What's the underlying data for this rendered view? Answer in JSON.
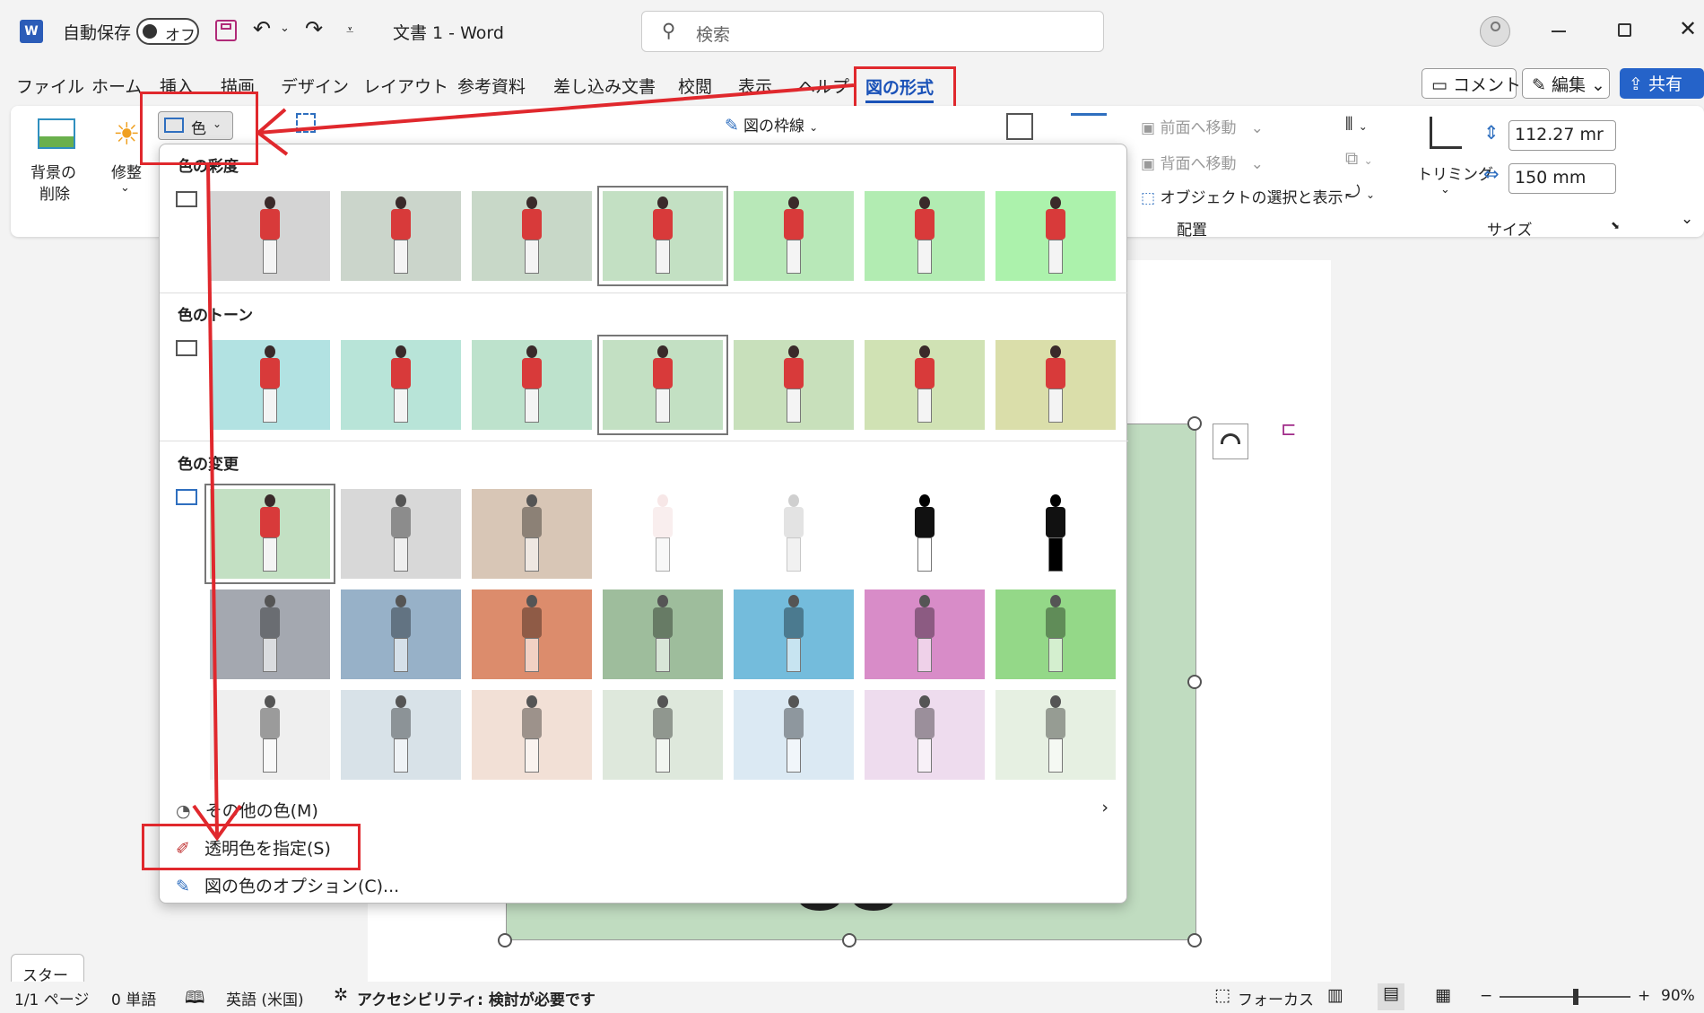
{
  "titlebar": {
    "app_icon": "word-icon",
    "autosave_label": "自動保存",
    "autosave_state": "オフ",
    "doc_title": "文書 1  -  Word",
    "search_placeholder": "検索"
  },
  "menu_tabs": [
    "ファイル",
    "ホーム",
    "挿入",
    "描画",
    "デザイン",
    "レイアウト",
    "参考資料",
    "差し込み文書",
    "校閲",
    "表示",
    "ヘルプ"
  ],
  "active_tab": "図の形式",
  "top_buttons": {
    "comment": "コメント",
    "edit": "編集",
    "share": "共有"
  },
  "ribbon": {
    "remove_bg": [
      "背景の",
      "削除"
    ],
    "corrections": "修整",
    "color_button": "色",
    "picture_border": "図の枠線",
    "bring_forward": "前面へ移動",
    "send_backward": "背面へ移動",
    "selection_pane": "オブジェクトの選択と表示",
    "arrange_group": "配置",
    "crop": "トリミング",
    "height_value": "112.27 mr",
    "width_value": "150 mm",
    "size_group": "サイズ"
  },
  "dropdown": {
    "saturation_title": "色の彩度",
    "tone_title": "色のトーン",
    "recolor_title": "色の変更",
    "more_colors": "その他の色(M)",
    "set_transparent": "透明色を指定(S)",
    "color_options": "図の色のオプション(C)...",
    "saturation_row": [
      "#d4d4d4",
      "#cbd5cb",
      "#c8d8c8",
      "#c3e0c3",
      "#b8e8b8",
      "#b2ecb2",
      "#acf2ac"
    ],
    "tone_row": [
      "#b2e2e2",
      "#b8e4d8",
      "#bde2cc",
      "#c3e0c3",
      "#c8e0bb",
      "#d0e2b4",
      "#dadeaa"
    ],
    "recolor_rows": [
      [
        "#c3e0c3",
        "#d8d8d8",
        "#d8c6b6",
        "#ffffff",
        "#ffffff",
        "#ffffff",
        "#ffffff"
      ],
      [
        "#a4a8b0",
        "#97b1c8",
        "#dc8c6c",
        "#9ebd9c",
        "#74bcdc",
        "#d88cc8",
        "#94d888"
      ],
      [
        "#efefef",
        "#d8e2e8",
        "#f2e0d6",
        "#dee8dc",
        "#dbe9f3",
        "#eedcee",
        "#e6f0e2"
      ]
    ]
  },
  "status": {
    "page": "1/1 ページ",
    "words": "0 単語",
    "language": "英語 (米国)",
    "accessibility": "アクセシビリティ: 検討が必要です",
    "focus": "フォーカス",
    "zoom": "90%",
    "zoom_fraction": 0.58
  },
  "start_button": "スタート",
  "annotation_color": "#e0282d"
}
